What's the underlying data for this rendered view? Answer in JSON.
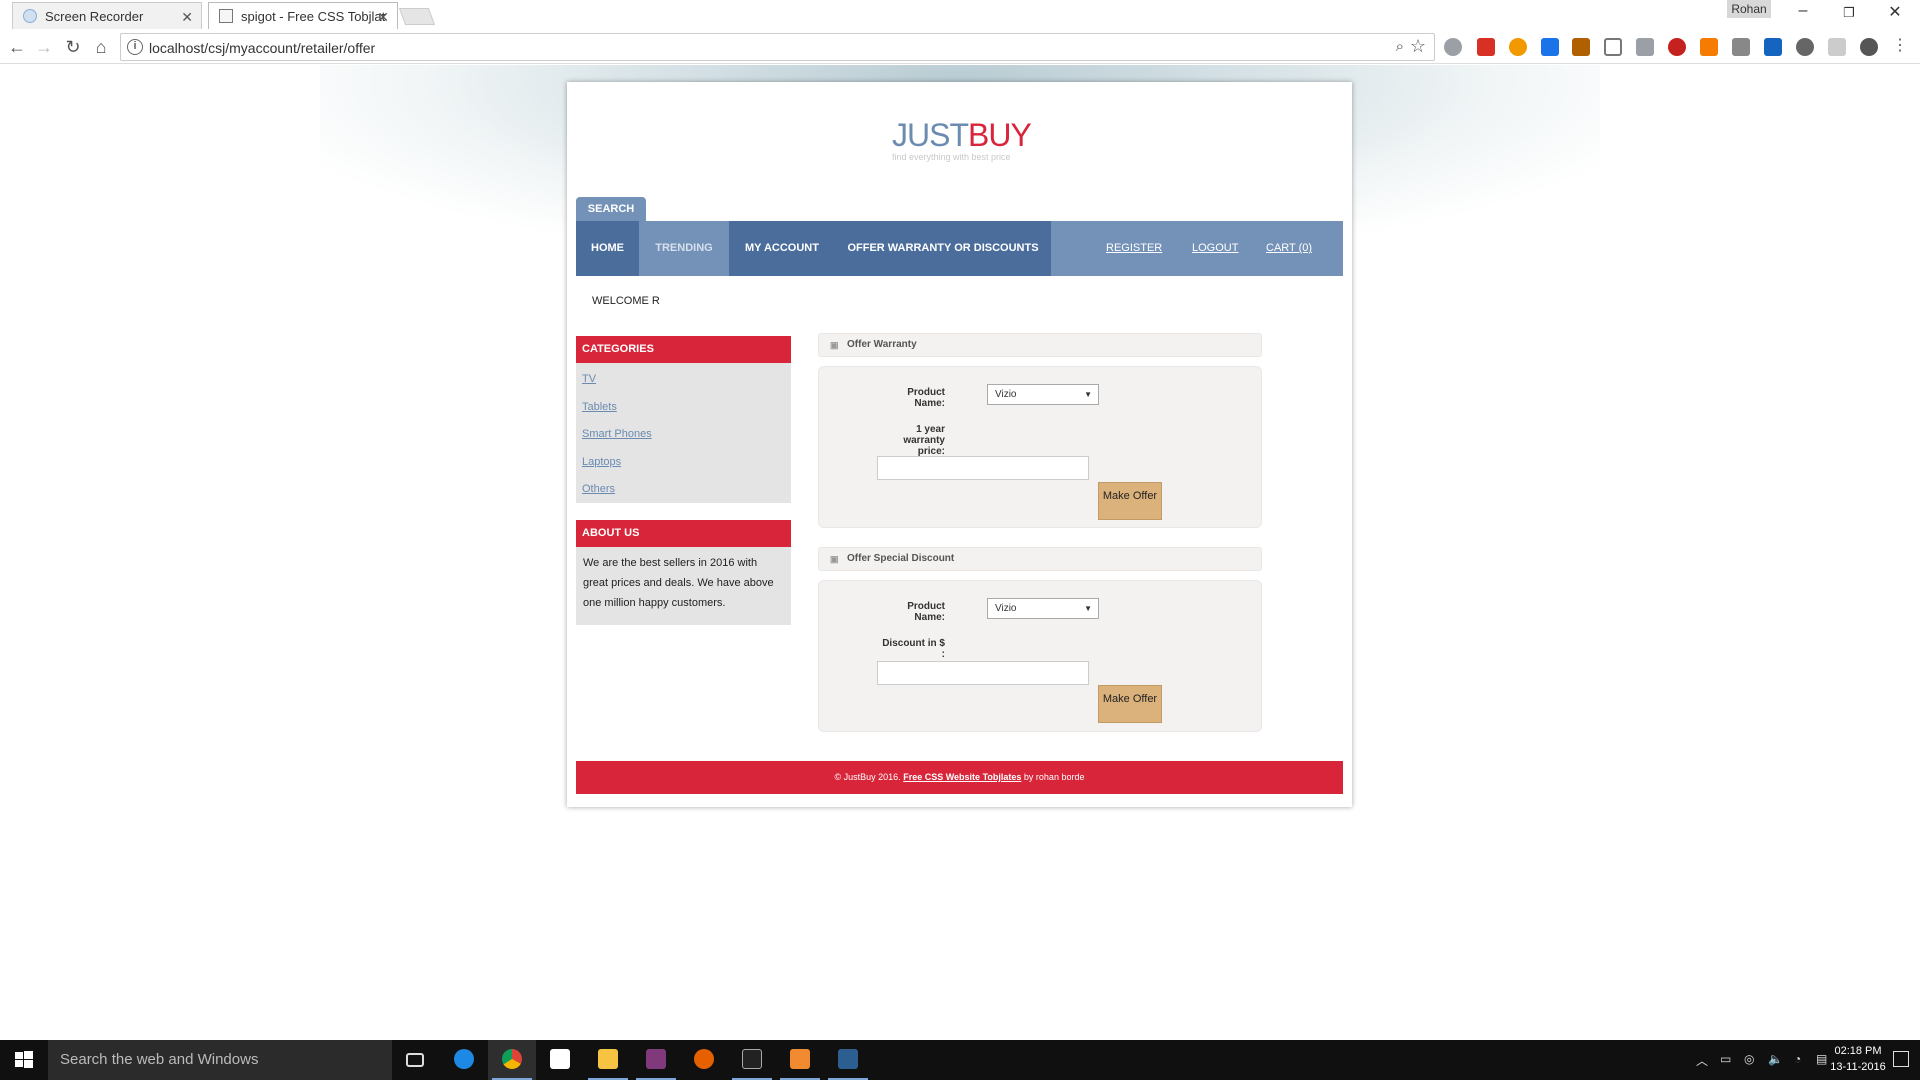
{
  "browser": {
    "tabs": [
      {
        "title": "Screen Recorder"
      },
      {
        "title": "spigot - Free CSS Tobjlat"
      }
    ],
    "profile": "Rohan",
    "url": "localhost/csj/myaccount/retailer/offer"
  },
  "site": {
    "logo_just": "JUST",
    "logo_buy": "BUY",
    "tagline": "find everything with best price",
    "search_tab": "SEARCH",
    "menu": {
      "home": "HOME",
      "trending": "TRENDING",
      "my_account": "MY ACCOUNT",
      "offer": "OFFER WARRANTY OR DISCOUNTS",
      "register": "REGISTER",
      "logout": "LOGOUT",
      "cart": "CART (0)"
    },
    "welcome": "WELCOME R",
    "categories": {
      "heading": "CATEGORIES",
      "items": [
        "TV",
        "Tablets",
        "Smart Phones",
        "Laptops",
        "Others"
      ]
    },
    "about": {
      "heading": "ABOUT US",
      "text": "We are the best sellers in 2016 with great prices and deals. We have above one million happy customers."
    },
    "warranty": {
      "heading": "Offer Warranty",
      "product_label": "Product Name:",
      "product_value": "Vizio",
      "price_label": "1 year warranty price:",
      "price_value": "",
      "button": "Make Offer"
    },
    "discount": {
      "heading": "Offer Special Discount",
      "product_label": "Product Name:",
      "product_value": "Vizio",
      "amount_label": "Discount in $ :",
      "amount_value": "",
      "button": "Make Offer"
    },
    "footer": {
      "copyright": "© JustBuy 2016.",
      "link": "Free CSS Website Tobjlates",
      "author": "by rohan borde"
    }
  },
  "taskbar": {
    "search_placeholder": "Search the web and Windows",
    "time": "02:18 PM",
    "date": "13-11-2016"
  },
  "colors": {
    "brand_blue": "#6b8bb0",
    "brand_red": "#d8253a",
    "menu_blue": "#7492b8",
    "menu_active": "#4a6d9c",
    "button_tan": "#dbb27c"
  }
}
